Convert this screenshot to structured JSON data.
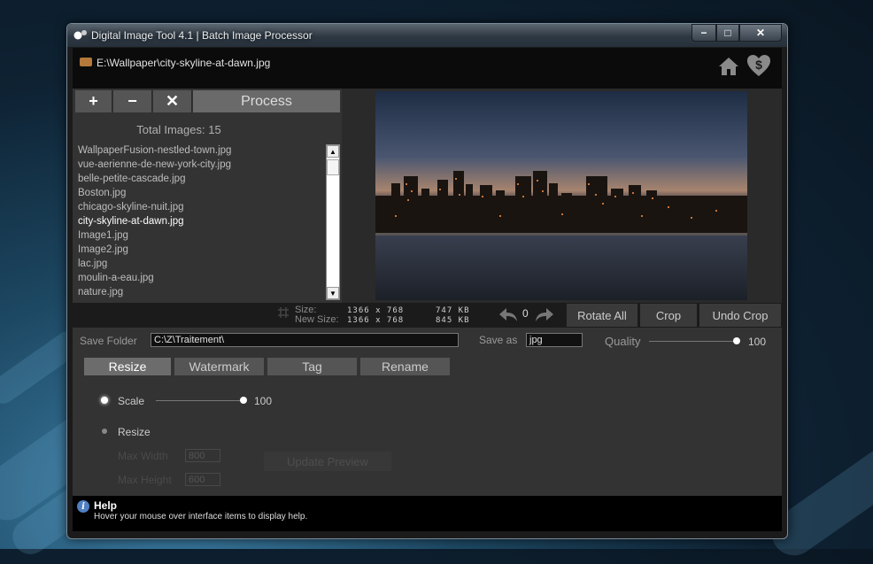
{
  "window": {
    "title": "Digital Image Tool 4.1  |  Batch Image Processor",
    "min": "−",
    "max": "□",
    "close": "✕"
  },
  "path": "E:\\Wallpaper\\city-skyline-at-dawn.jpg",
  "toolbar": {
    "add": "+",
    "remove": "−",
    "clear": "✕",
    "process": "Process"
  },
  "total_images": "Total Images: 15",
  "files": [
    "WallpaperFusion-nestled-town.jpg",
    "vue-aerienne-de-new-york-city.jpg",
    "belle-petite-cascade.jpg",
    "Boston.jpg",
    "chicago-skyline-nuit.jpg",
    "city-skyline-at-dawn.jpg",
    "Image1.jpg",
    "Image2.jpg",
    "lac.jpg",
    "moulin-a-eau.jpg",
    "nature.jpg"
  ],
  "info": {
    "size_label": "Size:",
    "new_size_label": "New Size:",
    "size_dims": "1366 x 768",
    "size_kb": "747 KB",
    "new_dims": "1366 x 768",
    "new_kb": "845 KB",
    "rotation": "0",
    "rotate_all": "Rotate  All",
    "crop": "Crop",
    "undo_crop": "Undo  Crop"
  },
  "options": {
    "save_folder_label": "Save  Folder",
    "save_folder": "C:\\Z\\Traitement\\",
    "save_as_label": "Save  as",
    "save_as": "jpg",
    "quality_label": "Quality",
    "quality": "100"
  },
  "tabs": [
    "Resize",
    "Watermark",
    "Tag",
    "Rename"
  ],
  "resize": {
    "scale_label": "Scale",
    "scale_value": "100",
    "resize_label": "Resize",
    "max_width_label": "Max  Width",
    "max_width": "800",
    "max_height_label": "Max  Height",
    "max_height": "600",
    "update_preview": "Update  Preview"
  },
  "help": {
    "title": "Help",
    "text": "Hover your mouse over interface items to display help."
  }
}
